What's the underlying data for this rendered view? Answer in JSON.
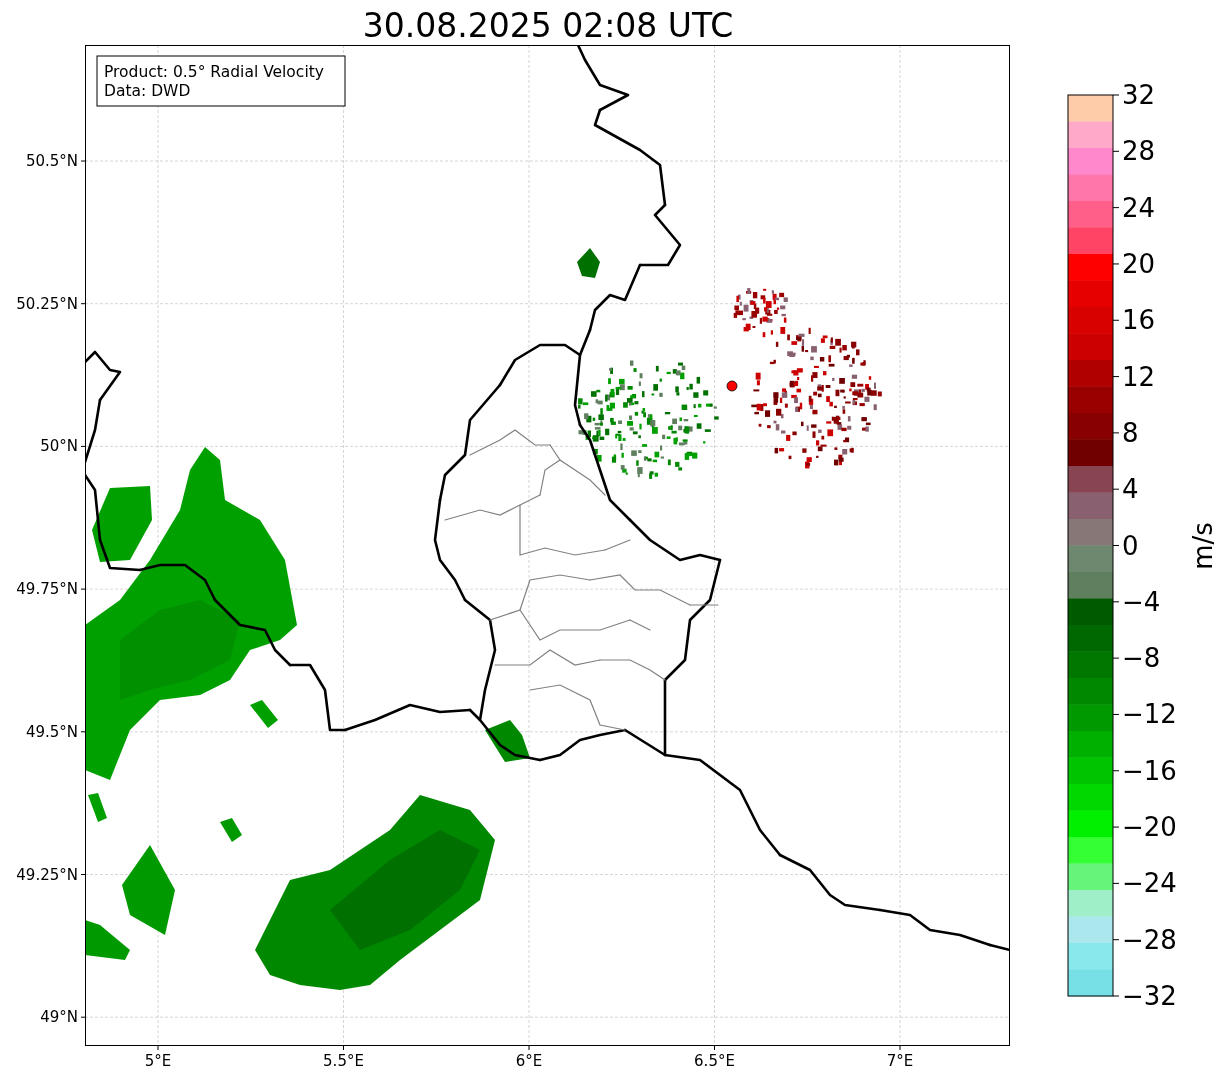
{
  "title": "30.08.2025 02:08 UTC",
  "info_box": {
    "lines": [
      "Product: 0.5° Radial Velocity",
      "Data: DWD"
    ]
  },
  "map": {
    "y_ticks": [
      "50.5°N",
      "50.25°N",
      "50°N",
      "49.75°N",
      "49.5°N",
      "49.25°N",
      "49°N"
    ],
    "x_ticks": [
      "5°E",
      "5.5°E",
      "6°E",
      "6.5°E",
      "7°E"
    ]
  },
  "colorbar": {
    "label": "m/s",
    "ticks": [
      "32",
      "28",
      "24",
      "20",
      "16",
      "12",
      "8",
      "4",
      "0",
      "−4",
      "−8",
      "−12",
      "−16",
      "−20",
      "−24",
      "−28",
      "−32"
    ],
    "bands": [
      {
        "color": "#ffccaa"
      },
      {
        "color": "#ffaac8"
      },
      {
        "color": "#ff88cc"
      },
      {
        "color": "#ff77aa"
      },
      {
        "color": "#ff5f88"
      },
      {
        "color": "#ff4466"
      },
      {
        "color": "#ff0000"
      },
      {
        "color": "#e60000"
      },
      {
        "color": "#d90000"
      },
      {
        "color": "#cc0000"
      },
      {
        "color": "#b00000"
      },
      {
        "color": "#990000"
      },
      {
        "color": "#880000"
      },
      {
        "color": "#700000"
      },
      {
        "color": "#884450"
      },
      {
        "color": "#886070"
      },
      {
        "color": "#887777"
      },
      {
        "color": "#6e8870"
      },
      {
        "color": "#5f7f5f"
      },
      {
        "color": "#005a00"
      },
      {
        "color": "#006800"
      },
      {
        "color": "#007800"
      },
      {
        "color": "#008800"
      },
      {
        "color": "#009900"
      },
      {
        "color": "#00b000"
      },
      {
        "color": "#00c400"
      },
      {
        "color": "#00d800"
      },
      {
        "color": "#00f000"
      },
      {
        "color": "#33ff33"
      },
      {
        "color": "#66f57a"
      },
      {
        "color": "#9ff0c8"
      },
      {
        "color": "#aae8ee"
      },
      {
        "color": "#88e8ec"
      },
      {
        "color": "#77e0e6"
      }
    ]
  }
}
